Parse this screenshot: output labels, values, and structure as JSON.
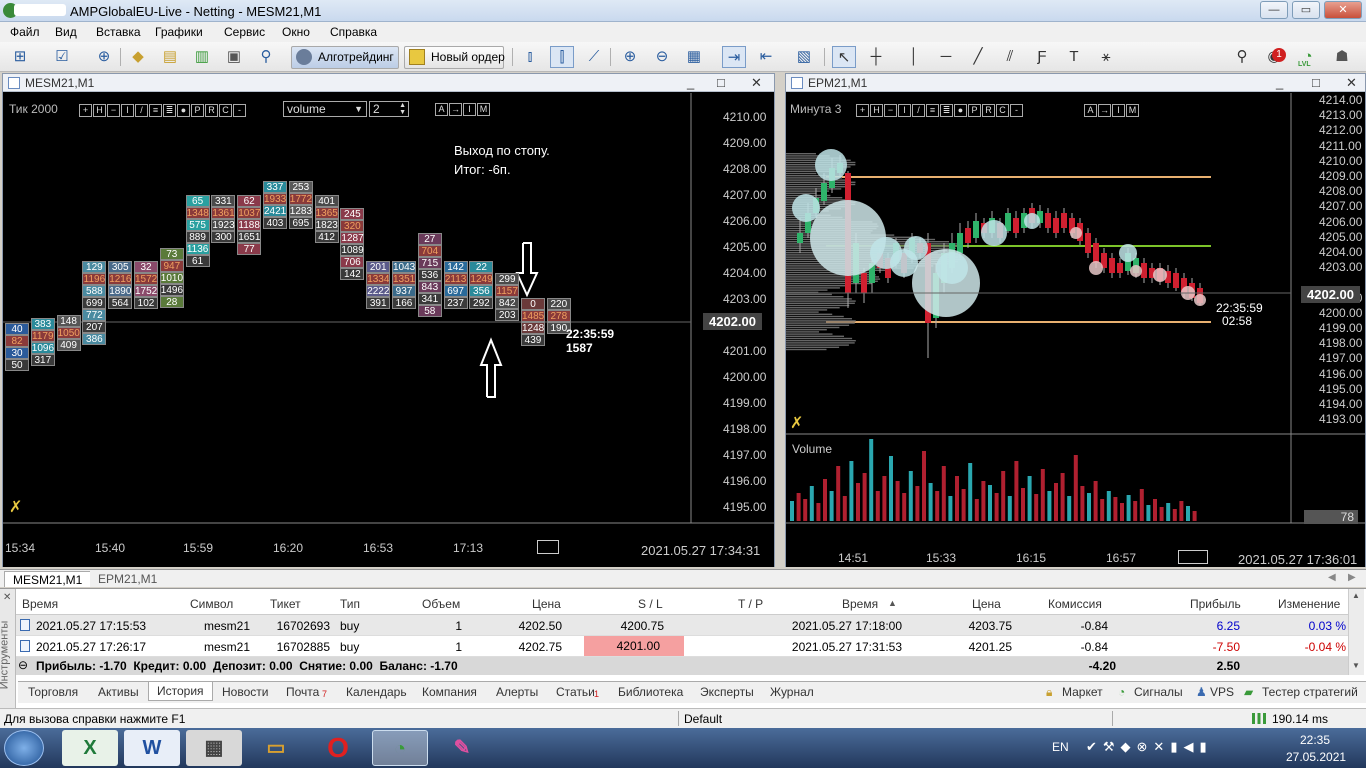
{
  "window": {
    "title": "AMPGlobalEU-Live - Netting - MESM21,M1"
  },
  "menu": [
    "Файл",
    "Вид",
    "Вставка",
    "Графики",
    "Сервис",
    "Окно",
    "Справка"
  ],
  "toolbar": {
    "algo_label": "Алготрейдинг",
    "new_order_label": "Новый ордер",
    "notify_count": "1",
    "lvl_label": "LVL"
  },
  "left_chart": {
    "title": "MESM21,M1",
    "mode_label": "Тик  2000",
    "indicator_select": "volume",
    "period_input": "2",
    "annotation_line1": "Выход по стопу.",
    "annotation_line2": "Итог: -6п.",
    "price_levels": [
      "4210.00",
      "4209.00",
      "4208.00",
      "4207.00",
      "4206.00",
      "4205.00",
      "4204.00",
      "4203.00",
      "4202.00",
      "4201.00",
      "4200.00",
      "4199.00",
      "4198.00",
      "4197.00",
      "4196.00",
      "4195.00"
    ],
    "current_price": "4202.00",
    "timer": "22:35:59",
    "timer_volume": "1587",
    "time_labels": [
      "15:34",
      "15:40",
      "15:59",
      "16:20",
      "16:53",
      "17:13"
    ],
    "datetime": "2021.05.27 17:34:31",
    "footprint_columns": [
      [
        "40",
        "383",
        "148",
        "129",
        "305",
        "32",
        "73",
        "65",
        "331",
        "62",
        "337",
        "253",
        "401",
        "245",
        "201",
        "1043",
        "27",
        "142",
        "22",
        "299",
        "0",
        "220"
      ],
      [
        "82",
        "1179",
        "1050",
        "1196",
        "1216",
        "1572",
        "947",
        "1348",
        "1361",
        "1037",
        "1933",
        "1772",
        "1365",
        "320",
        "1334",
        "1351",
        "704",
        "2113",
        "1249",
        "1157",
        "1485",
        "278"
      ],
      [
        "30",
        "1096",
        "409",
        "588",
        "1890",
        "1752",
        "1010",
        "575",
        "1923",
        "1188",
        "2421",
        "1283",
        "1823",
        "1287",
        "2222",
        "937",
        "715",
        "697",
        "356",
        "842",
        "1248",
        "190"
      ],
      [
        "50",
        "317",
        "",
        "699",
        "564",
        "102",
        "1496",
        "889",
        "300",
        "1651",
        "403",
        "695",
        "412",
        "1089",
        "391",
        "166",
        "536",
        "237",
        "292",
        "203",
        "439",
        ""
      ],
      [
        "",
        "",
        "",
        "772",
        "",
        "",
        "28",
        "1136",
        "",
        "77",
        "",
        "",
        "",
        "706",
        "",
        "",
        "843",
        "",
        "",
        "",
        "",
        ""
      ],
      [
        "",
        "",
        "",
        "207",
        "",
        "",
        "",
        "61",
        "",
        "",
        "",
        "",
        "",
        "142",
        "",
        "",
        "341",
        "",
        "",
        "",
        "",
        ""
      ],
      [
        "",
        "",
        "",
        "386",
        "",
        "",
        "",
        "",
        "",
        "",
        "",
        "",
        "",
        "",
        "",
        "",
        "58",
        "",
        "",
        "",
        "",
        ""
      ]
    ]
  },
  "right_chart": {
    "title": "EPM21,M1",
    "mode_label": "Минута  3",
    "price_levels": [
      "4214.00",
      "4213.00",
      "4212.00",
      "4211.00",
      "4210.00",
      "4209.00",
      "4208.00",
      "4207.00",
      "4206.00",
      "4205.00",
      "4204.00",
      "4203.00",
      "4202.00",
      "4201.00",
      "4200.00",
      "4199.00",
      "4198.00",
      "4197.00",
      "4196.00",
      "4195.00",
      "4194.00",
      "4193.00"
    ],
    "current_price": "4202.00",
    "timer": "22:35:59",
    "timer_remaining": "02:58",
    "volume_label": "Volume",
    "volume_value": "78",
    "time_labels": [
      "14:51",
      "15:33",
      "16:15",
      "16:57"
    ],
    "datetime": "2021.05.27 17:36:01",
    "volume_bars": [
      20,
      28,
      22,
      35,
      18,
      42,
      30,
      55,
      25,
      60,
      38,
      48,
      82,
      30,
      45,
      65,
      40,
      28,
      50,
      35,
      70,
      38,
      30,
      55,
      25,
      45,
      32,
      58,
      22,
      40,
      36,
      28,
      50,
      25,
      60,
      33,
      45,
      27,
      52,
      30,
      38,
      48,
      25,
      66,
      35,
      28,
      40,
      22,
      30,
      24,
      18,
      26,
      20,
      32,
      16,
      22,
      14,
      18,
      12,
      20,
      15,
      10
    ]
  },
  "chart_tabs": [
    "MESM21,M1",
    "EPM21,M1"
  ],
  "table": {
    "headers": [
      "Время",
      "Символ",
      "Тикет",
      "Тип",
      "Объем",
      "Цена",
      "S / L",
      "T / P",
      "Время",
      "Цена",
      "Комиссия",
      "Прибыль",
      "Изменение"
    ],
    "rows": [
      [
        "2021.05.27 17:15:53",
        "mesm21",
        "16702693",
        "buy",
        "1",
        "4202.50",
        "4200.75",
        "",
        "2021.05.27 17:18:00",
        "4203.75",
        "-0.84",
        "6.25",
        "0.03 %"
      ],
      [
        "2021.05.27 17:26:17",
        "mesm21",
        "16702885",
        "buy",
        "1",
        "4202.75",
        "4201.00",
        "",
        "2021.05.27 17:31:53",
        "4201.25",
        "-0.84",
        "-7.50",
        "-0.04 %"
      ]
    ],
    "summary": "Прибыль: -1.70  Кредит: 0.00  Депозит: 0.00  Снятие: 0.00  Баланс: -1.70",
    "total_commission": "-4.20",
    "total_profit": "2.50",
    "side_label": "Инструменты"
  },
  "bottom_tabs": [
    "Торговля",
    "Активы",
    "История",
    "Новости",
    "Почта",
    "Календарь",
    "Компания",
    "Алерты",
    "Статьи",
    "Библиотека",
    "Эксперты",
    "Журнал"
  ],
  "mail_badge": "7",
  "articles_badge": "1",
  "bottom_right": [
    "Маркет",
    "Сигналы",
    "VPS",
    "Тестер стратегий"
  ],
  "status": {
    "help": "Для вызова справки нажмите F1",
    "profile": "Default",
    "ping": "190.14 ms"
  },
  "taskbar": {
    "lang": "EN",
    "time": "22:35",
    "date": "27.05.2021"
  },
  "colors": {
    "accent_green": "#7dc42a",
    "profit_blue": "#0000cc",
    "loss_red": "#cc0000",
    "sl_highlight": "#f5a0a0"
  }
}
